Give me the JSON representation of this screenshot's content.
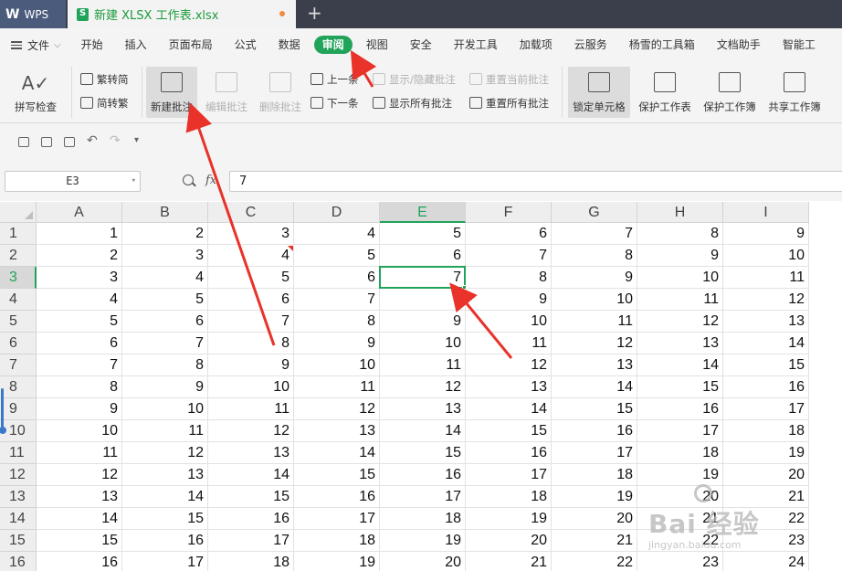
{
  "titlebar": {
    "app_name": "WPS",
    "doc_tab_title": "新建 XLSX 工作表.xlsx",
    "new_tab_symbol": "+"
  },
  "menu": {
    "file_label": "文件",
    "items": [
      "开始",
      "插入",
      "页面布局",
      "公式",
      "数据",
      "审阅",
      "视图",
      "安全",
      "开发工具",
      "加载项",
      "云服务",
      "杨雪的工具箱",
      "文档助手",
      "智能工"
    ],
    "active_item": "审阅"
  },
  "ribbon": {
    "spell_check": "拼写检查",
    "trad_simp": "繁转简",
    "simp_trad": "简转繁",
    "new_comment": "新建批注",
    "edit_comment": "编辑批注",
    "delete_comment": "删除批注",
    "prev": "上一条",
    "next": "下一条",
    "show_hide_comment": "显示/隐藏批注",
    "show_all_comments": "显示所有批注",
    "reset_current_comment": "重置当前批注",
    "reset_all_comments": "重置所有批注",
    "lock_cell": "锁定单元格",
    "protect_sheet": "保护工作表",
    "protect_workbook": "保护工作簿",
    "share_workbook": "共享工作簿"
  },
  "formula_bar": {
    "name_box": "E3",
    "fx_label": "fx",
    "value": "7"
  },
  "grid": {
    "columns": [
      "A",
      "B",
      "C",
      "D",
      "E",
      "F",
      "G",
      "H",
      "I"
    ],
    "rows": [
      [
        1,
        2,
        3,
        4,
        5,
        6,
        7,
        8,
        9
      ],
      [
        2,
        3,
        4,
        5,
        6,
        7,
        8,
        9,
        10
      ],
      [
        3,
        4,
        5,
        6,
        7,
        8,
        9,
        10,
        11
      ],
      [
        4,
        5,
        6,
        7,
        8,
        9,
        10,
        11,
        12
      ],
      [
        5,
        6,
        7,
        8,
        9,
        10,
        11,
        12,
        13
      ],
      [
        6,
        7,
        8,
        9,
        10,
        11,
        12,
        13,
        14
      ],
      [
        7,
        8,
        9,
        10,
        11,
        12,
        13,
        14,
        15
      ],
      [
        8,
        9,
        10,
        11,
        12,
        13,
        14,
        15,
        16
      ],
      [
        9,
        10,
        11,
        12,
        13,
        14,
        15,
        16,
        17
      ],
      [
        10,
        11,
        12,
        13,
        14,
        15,
        16,
        17,
        18
      ],
      [
        11,
        12,
        13,
        14,
        15,
        16,
        17,
        18,
        19
      ],
      [
        12,
        13,
        14,
        15,
        16,
        17,
        18,
        19,
        20
      ],
      [
        13,
        14,
        15,
        16,
        17,
        18,
        19,
        20,
        21
      ],
      [
        14,
        15,
        16,
        17,
        18,
        19,
        20,
        21,
        22
      ],
      [
        15,
        16,
        17,
        18,
        19,
        20,
        21,
        22,
        23
      ],
      [
        16,
        17,
        18,
        19,
        20,
        21,
        22,
        23,
        24
      ]
    ],
    "active_cell": "E3",
    "comment_cell": "C2"
  },
  "watermark": {
    "main": "Bai  经验",
    "sub": "jingyan.baidu.com"
  },
  "colors": {
    "accent": "#21a35a",
    "arrow": "#e8322a",
    "titlebar_bg": "#3a3f4b"
  }
}
